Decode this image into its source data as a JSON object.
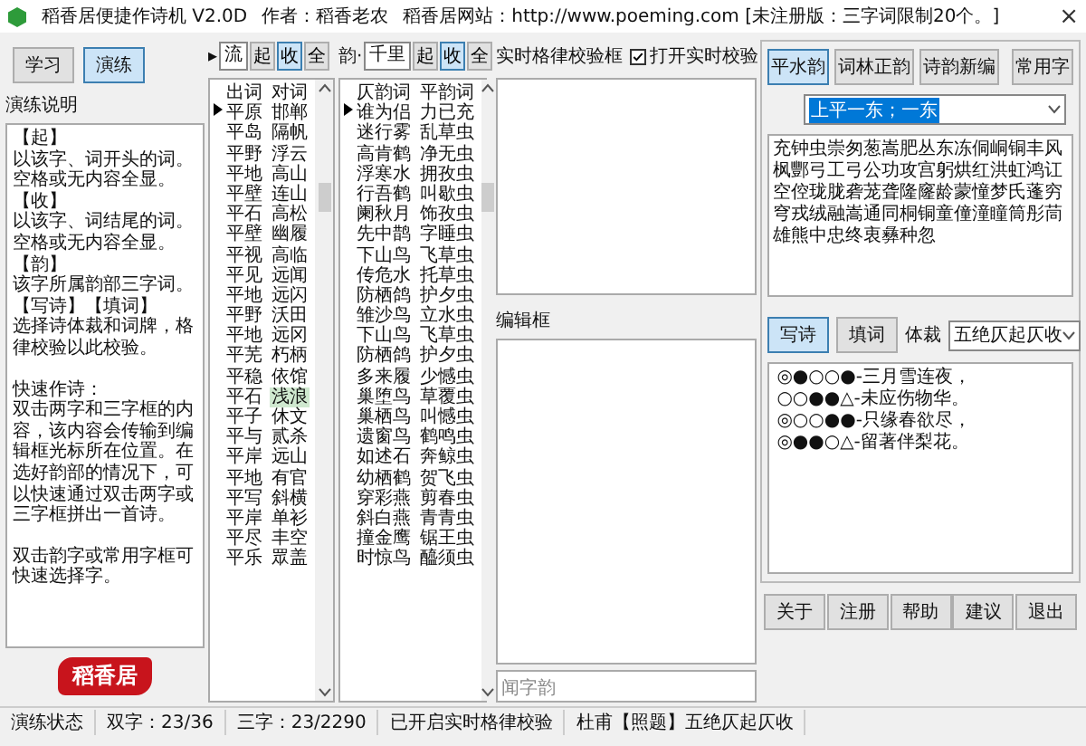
{
  "window": {
    "title": "稻香居便捷作诗机 V2.0D",
    "author": "作者：稻香老农",
    "website": "稻香居网站：http://www.poeming.com [未注册版：三字词限制20个。]",
    "close": "×"
  },
  "mode_tabs": [
    {
      "label": "学习",
      "selected": false
    },
    {
      "label": "演练",
      "selected": true
    }
  ],
  "instructions": {
    "label": "演练说明",
    "paragraphs": [
      [
        "【起】",
        "以该字、词开头的词。",
        "空格或无内容全显。",
        "【收】",
        "以该字、词结尾的词。",
        "空格或无内容全显。",
        "【韵】",
        "该字所属韵部三字词。",
        "【写诗】【填词】",
        "选择诗体裁和词牌，格律校验以此校验。"
      ],
      [
        "快速作诗：",
        "双击两字和三字框的内容，该内容会传输到编辑框光标所在位置。在选好韵部的情况下，可以快速通过双击两字或三字框拼出一首诗。"
      ],
      [
        "双击韵字或常用字框可快速选择字。"
      ]
    ]
  },
  "logo": {
    "text": "稻香居"
  },
  "two_char_panel": {
    "marker": "▸",
    "input": "流",
    "filter_buttons": [
      {
        "label": "起",
        "selected": false
      },
      {
        "label": "收",
        "selected": true
      },
      {
        "label": "全",
        "selected": false
      }
    ],
    "columns": [
      "出词",
      "对词"
    ],
    "rows": [
      {
        "cells": [
          "平原",
          "邯郸"
        ],
        "current": true,
        "selected": false
      },
      {
        "cells": [
          "平岛",
          "隔帆"
        ],
        "current": false,
        "selected": false
      },
      {
        "cells": [
          "平野",
          "浮云"
        ],
        "current": false,
        "selected": false
      },
      {
        "cells": [
          "平地",
          "高山"
        ],
        "current": false,
        "selected": false
      },
      {
        "cells": [
          "平壁",
          "连山"
        ],
        "current": false,
        "selected": false
      },
      {
        "cells": [
          "平石",
          "高松"
        ],
        "current": false,
        "selected": false
      },
      {
        "cells": [
          "平壁",
          "幽履"
        ],
        "current": false,
        "selected": false
      },
      {
        "cells": [
          "平视",
          "高临"
        ],
        "current": false,
        "selected": false
      },
      {
        "cells": [
          "平见",
          "远闻"
        ],
        "current": false,
        "selected": false
      },
      {
        "cells": [
          "平地",
          "远闪"
        ],
        "current": false,
        "selected": false
      },
      {
        "cells": [
          "平野",
          "沃田"
        ],
        "current": false,
        "selected": false
      },
      {
        "cells": [
          "平地",
          "远冈"
        ],
        "current": false,
        "selected": false
      },
      {
        "cells": [
          "平芜",
          "朽柄"
        ],
        "current": false,
        "selected": false
      },
      {
        "cells": [
          "平稳",
          "依馆"
        ],
        "current": false,
        "selected": false
      },
      {
        "cells": [
          "平石",
          "浅浪"
        ],
        "current": false,
        "selected": true
      },
      {
        "cells": [
          "平子",
          "休文"
        ],
        "current": false,
        "selected": false
      },
      {
        "cells": [
          "平与",
          "贰杀"
        ],
        "current": false,
        "selected": false
      },
      {
        "cells": [
          "平岸",
          "远山"
        ],
        "current": false,
        "selected": false
      },
      {
        "cells": [
          "平地",
          "有官"
        ],
        "current": false,
        "selected": false
      },
      {
        "cells": [
          "平写",
          "斜横"
        ],
        "current": false,
        "selected": false
      },
      {
        "cells": [
          "平岸",
          "单衫"
        ],
        "current": false,
        "selected": false
      },
      {
        "cells": [
          "平尽",
          "丰空"
        ],
        "current": false,
        "selected": false
      },
      {
        "cells": [
          "平乐",
          "眾盖"
        ],
        "current": false,
        "selected": false
      }
    ]
  },
  "three_char_panel": {
    "label": "韵·",
    "input": "千里",
    "filter_buttons": [
      {
        "label": "起",
        "selected": false
      },
      {
        "label": "收",
        "selected": true
      },
      {
        "label": "全",
        "selected": false
      }
    ],
    "columns": [
      "仄韵词",
      "平韵词"
    ],
    "rows": [
      {
        "cells": [
          "谁为侣",
          "力已充"
        ],
        "current": true
      },
      {
        "cells": [
          "迷行雾",
          "乱草虫"
        ],
        "current": false
      },
      {
        "cells": [
          "高肯鹤",
          "净无虫"
        ],
        "current": false
      },
      {
        "cells": [
          "浮寒水",
          "拥孜虫"
        ],
        "current": false
      },
      {
        "cells": [
          "行吾鹤",
          "叫歇虫"
        ],
        "current": false
      },
      {
        "cells": [
          "阑秋月",
          "饰孜虫"
        ],
        "current": false
      },
      {
        "cells": [
          "先中鹊",
          "字睡虫"
        ],
        "current": false
      },
      {
        "cells": [
          "下山鸟",
          "飞草虫"
        ],
        "current": false
      },
      {
        "cells": [
          "传危水",
          "托草虫"
        ],
        "current": false
      },
      {
        "cells": [
          "防栖鸽",
          "护夕虫"
        ],
        "current": false
      },
      {
        "cells": [
          "雏沙鸟",
          "立水虫"
        ],
        "current": false
      },
      {
        "cells": [
          "下山鸟",
          "飞草虫"
        ],
        "current": false
      },
      {
        "cells": [
          "防栖鸽",
          "护夕虫"
        ],
        "current": false
      },
      {
        "cells": [
          "多来履",
          "少憾虫"
        ],
        "current": false
      },
      {
        "cells": [
          "巢堕鸟",
          "草覆虫"
        ],
        "current": false
      },
      {
        "cells": [
          "巢栖鸟",
          "叫憾虫"
        ],
        "current": false
      },
      {
        "cells": [
          "遗窗鸟",
          "鹤鸣虫"
        ],
        "current": false
      },
      {
        "cells": [
          "如述石",
          "奔鲸虫"
        ],
        "current": false
      },
      {
        "cells": [
          "幼栖鹤",
          "贺飞虫"
        ],
        "current": false
      },
      {
        "cells": [
          "穿彩燕",
          "剪春虫"
        ],
        "current": false
      },
      {
        "cells": [
          "斜白燕",
          "青青虫"
        ],
        "current": false
      },
      {
        "cells": [
          "撞金鹰",
          "锯王虫"
        ],
        "current": false
      },
      {
        "cells": [
          "时惊鸟",
          "醯须虫"
        ],
        "current": false
      }
    ]
  },
  "checker": {
    "label": "实时格律校验框",
    "checkbox": {
      "label": "打开实时校验",
      "checked": true
    }
  },
  "editor": {
    "label": "编辑框"
  },
  "rhyme_field": {
    "placeholder": "闻字韵"
  },
  "rhyme_books": [
    {
      "label": "平水韵",
      "selected": true
    },
    {
      "label": "词林正韵",
      "selected": false
    },
    {
      "label": "诗韵新编",
      "selected": false
    }
  ],
  "common_button": "常用字",
  "rhyme_select": {
    "value": "上平一东；一东"
  },
  "rhyme_chars": "充钟虫崇匆葱嵩肥丛东冻侗峒铜丰风枫酆弓工弓公功攻宫躬烘红洪虹鸿讧空倥珑胧砻茏聋隆窿龄蒙憧梦氏蓬穷穹戎绒融嵩通同桐铜童僮潼瞳筒彤茼雄熊中忠终衷彝种忽",
  "poem_tabs": [
    {
      "label": "写诗",
      "selected": true
    },
    {
      "label": "填词",
      "selected": false
    }
  ],
  "form": {
    "label": "体裁",
    "value": "五绝仄起仄收"
  },
  "pattern_lines": [
    "◎●○○●-三月雪连夜，",
    "○○●●△-未应伤物华。",
    "◎○○●●-只缘春欲尽，",
    "◎●●○△-留著伴梨花。"
  ],
  "buttons": [
    "关于",
    "注册",
    "帮助",
    "建议",
    "退出"
  ],
  "status_bar": [
    "演练状态",
    "双字：23/36",
    "三字：23/2290",
    "已开启实时格律校验",
    "杜甫【照题】五绝仄起仄收"
  ]
}
